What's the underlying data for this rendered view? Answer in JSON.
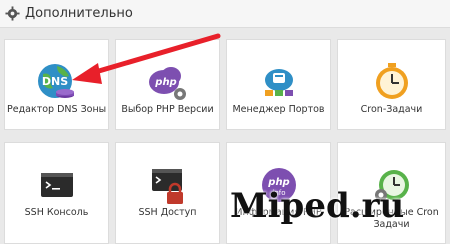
{
  "header": {
    "title": "Дополнительно",
    "icon": "gear-icon"
  },
  "cards": [
    {
      "label": "Редактор DNS Зоны",
      "icon": "dns-globe-icon"
    },
    {
      "label": "Выбор PHP Версии",
      "icon": "php-cloud-icon"
    },
    {
      "label": "Менеджер Портов",
      "icon": "port-manager-icon"
    },
    {
      "label": "Cron-Задачи",
      "icon": "cron-clock-icon"
    },
    {
      "label": "SSH Консоль",
      "icon": "terminal-icon"
    },
    {
      "label": "SSH Доступ",
      "icon": "terminal-lock-icon"
    },
    {
      "label": "Информация PHP",
      "icon": "php-info-icon"
    },
    {
      "label": "Расширенные Cron Задачи",
      "icon": "advanced-cron-icon"
    }
  ],
  "watermark": "Miped.ru",
  "colors": {
    "arrow": "#e8202a",
    "accent_purple": "#7b3fa6",
    "page_bg": "#e9e9e9"
  }
}
